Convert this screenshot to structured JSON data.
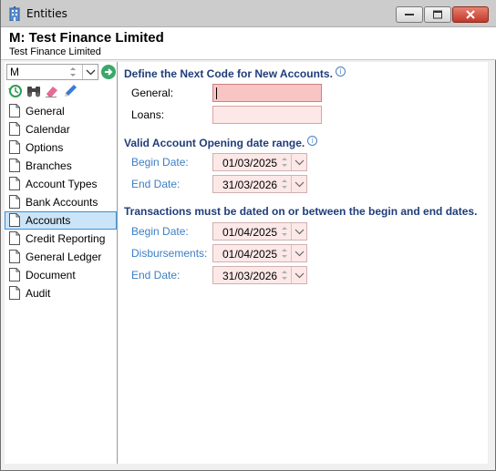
{
  "window": {
    "title": "Entities",
    "icon": "building-icon"
  },
  "header": {
    "title": "M: Test Finance Limited",
    "subtitle": "Test Finance Limited"
  },
  "sidebar": {
    "entity_value": "M",
    "toolbar": [
      "history-icon",
      "binoculars-icon",
      "eraser-icon",
      "pencil-icon"
    ],
    "items": [
      {
        "label": "General"
      },
      {
        "label": "Calendar"
      },
      {
        "label": "Options"
      },
      {
        "label": "Branches"
      },
      {
        "label": "Account Types"
      },
      {
        "label": "Bank Accounts"
      },
      {
        "label": "Accounts",
        "selected": true
      },
      {
        "label": "Credit Reporting"
      },
      {
        "label": "General Ledger"
      },
      {
        "label": "Document"
      },
      {
        "label": "Audit"
      }
    ]
  },
  "main": {
    "next_code": {
      "title": "Define the Next Code for New Accounts.",
      "general_label": "General:",
      "general_value": "",
      "loans_label": "Loans:",
      "loans_value": ""
    },
    "opening_range": {
      "title": "Valid Account Opening date range.",
      "begin_label": "Begin Date:",
      "begin_value": "01/03/2025",
      "end_label": "End Date:",
      "end_value": "31/03/2026"
    },
    "transactions_range": {
      "title": "Transactions must be dated on or between the begin and end dates.",
      "begin_label": "Begin Date:",
      "begin_value": "01/04/2025",
      "disb_label": "Disbursements:",
      "disb_value": "01/04/2025",
      "end_label": "End Date:",
      "end_value": "31/03/2026"
    }
  },
  "colors": {
    "section_title": "#1f3d7a",
    "date_label": "#3c7fc6",
    "required_field": "#f9c4c4",
    "selected_nav": "#cce4f7"
  }
}
